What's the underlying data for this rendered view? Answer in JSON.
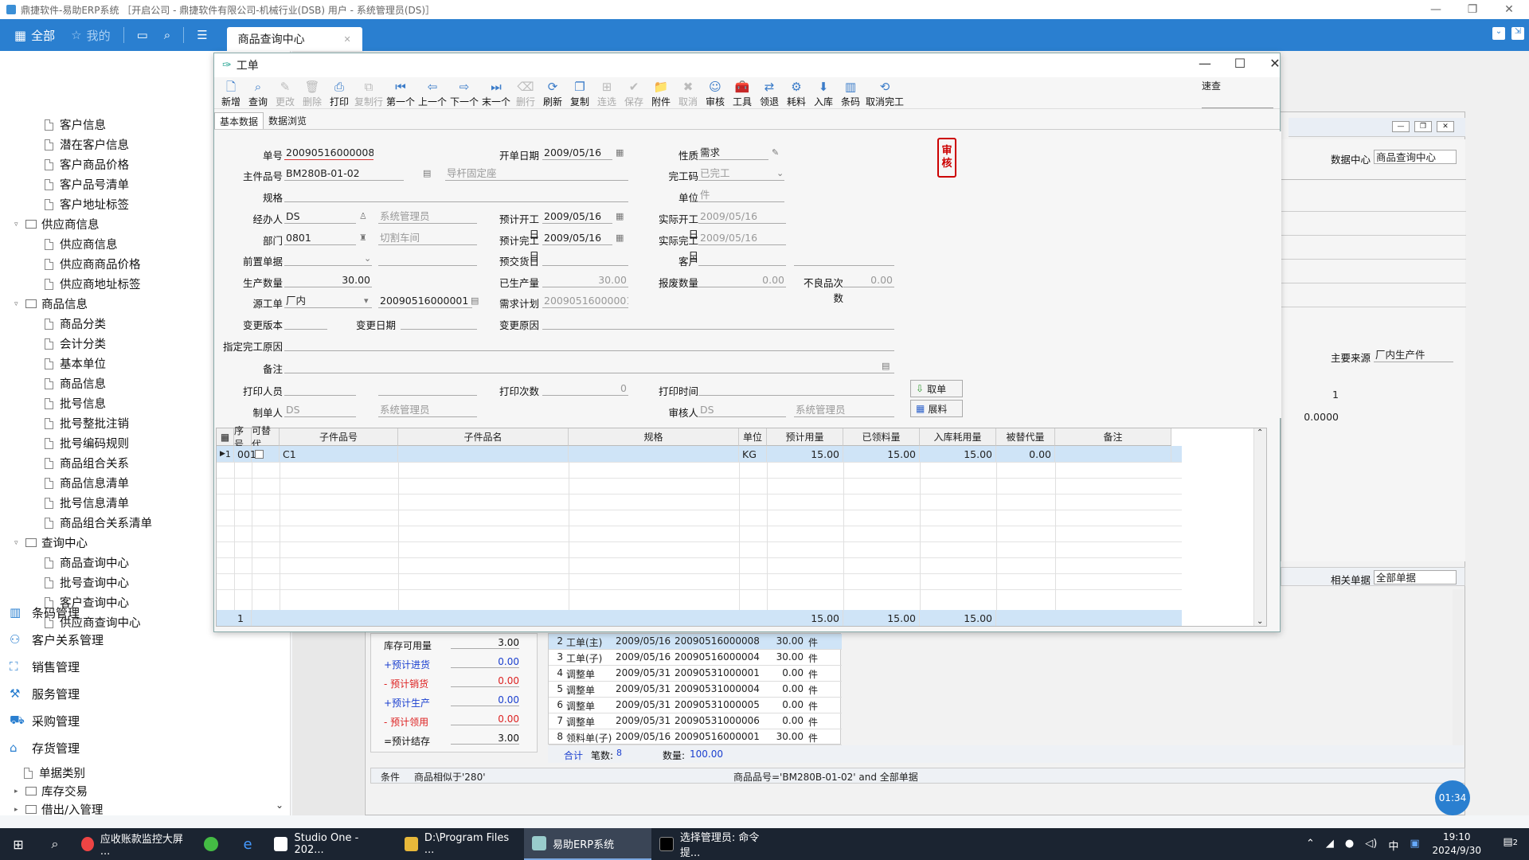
{
  "titlebar": {
    "title": "鼎捷软件-易助ERP系统 ［开启公司 - 鼎捷软件有限公司-机械行业(DSB)  用户 - 系统管理员(DS)］"
  },
  "topnav": {
    "all": "全部",
    "mine": "我的",
    "active_tab": "商品查询中心"
  },
  "leftnav": {
    "rows": [
      {
        "label": "客户信息",
        "indent": 2
      },
      {
        "label": "潜在客户信息",
        "indent": 2
      },
      {
        "label": "客户商品价格",
        "indent": 2
      },
      {
        "label": "客户品号清单",
        "indent": 2
      },
      {
        "label": "客户地址标签",
        "indent": 2
      },
      {
        "label": "供应商信息",
        "indent": 1
      },
      {
        "label": "供应商信息",
        "indent": 2
      },
      {
        "label": "供应商商品价格",
        "indent": 2
      },
      {
        "label": "供应商地址标签",
        "indent": 2
      },
      {
        "label": "商品信息",
        "indent": 1
      },
      {
        "label": "商品分类",
        "indent": 2
      },
      {
        "label": "会计分类",
        "indent": 2
      },
      {
        "label": "基本单位",
        "indent": 2
      },
      {
        "label": "商品信息",
        "indent": 2
      },
      {
        "label": "批号信息",
        "indent": 2
      },
      {
        "label": "批号整批注销",
        "indent": 2
      },
      {
        "label": "批号编码规则",
        "indent": 2
      },
      {
        "label": "商品组合关系",
        "indent": 2
      },
      {
        "label": "商品信息清单",
        "indent": 2
      },
      {
        "label": "批号信息清单",
        "indent": 2
      },
      {
        "label": "商品组合关系清单",
        "indent": 2
      },
      {
        "label": "查询中心",
        "indent": 1
      },
      {
        "label": "商品查询中心",
        "indent": 2
      },
      {
        "label": "批号查询中心",
        "indent": 2
      },
      {
        "label": "客户查询中心",
        "indent": 2
      },
      {
        "label": "供应商查询中心",
        "indent": 2
      }
    ],
    "modules": [
      "条码管理",
      "客户关系管理",
      "销售管理",
      "服务管理",
      "采购管理",
      "存货管理"
    ],
    "subitems": [
      "单据类别",
      "库存交易",
      "借出/入管理"
    ]
  },
  "dialog": {
    "title": "工单",
    "toolbar": [
      "新增",
      "查询",
      "更改",
      "删除",
      "打印",
      "复制行",
      "第一个",
      "上一个",
      "下一个",
      "末一个",
      "删行",
      "刷新",
      "复制",
      "连选",
      "保存",
      "附件",
      "取消",
      "审核",
      "工具",
      "领退",
      "耗料",
      "入库",
      "条码",
      "取消完工"
    ],
    "toolbar_disabled": [
      2,
      3,
      5,
      10,
      13,
      14,
      16
    ],
    "speed_label": "速查",
    "tabs": [
      "基本数据",
      "数据浏览"
    ],
    "form": {
      "order_no_label": "单号",
      "order_no": "20090516000008",
      "open_date_label": "开单日期",
      "open_date": "2009/05/16",
      "nature_label": "性质",
      "nature": "需求",
      "main_item_label": "主件品号",
      "main_item": "BM280B-01-02",
      "main_item_name": "导杆固定座",
      "finish_code_label": "完工码",
      "finish_code": "已完工",
      "spec_label": "规格",
      "unit_label": "单位",
      "unit": "件",
      "handler_label": "经办人",
      "handler": "DS",
      "handler_name": "系统管理员",
      "plan_start_label": "预计开工日",
      "plan_start": "2009/05/16",
      "actual_start_label": "实际开工日",
      "actual_start": "2009/05/16",
      "dept_label": "部门",
      "dept": "0801",
      "dept_name": "切割车间",
      "plan_finish_label": "预计完工日",
      "plan_finish": "2009/05/16",
      "actual_finish_label": "实际完工日",
      "actual_finish": "2009/05/16",
      "pre_doc_label": "前置单据",
      "pre_delivery_label": "预交货日",
      "customer_label": "客户",
      "prod_qty_label": "生产数量",
      "prod_qty": "30.00",
      "produced_label": "已生产量",
      "produced": "30.00",
      "scrap_label": "报废数量",
      "scrap": "0.00",
      "defect_label": "不良品次数",
      "defect": "0.00",
      "source_label": "源工单",
      "source": "厂内",
      "source_no": "20090516000001",
      "demand_label": "需求计划",
      "demand": "20090516000001-0",
      "change_ver_label": "变更版本",
      "change_date_label": "变更日期",
      "change_reason_label": "变更原因",
      "finish_reason_label": "指定完工原因",
      "remark_label": "备注",
      "printer_label": "打印人员",
      "print_count_label": "打印次数",
      "print_count": "0",
      "print_time_label": "打印时间",
      "maker_label": "制单人",
      "maker": "DS",
      "maker_name": "系统管理员",
      "auditor_label": "审核人",
      "auditor": "DS",
      "auditor_name": "系统管理员",
      "seal": [
        "审",
        "核"
      ],
      "fetch_btn": "取单",
      "expand_btn": "展料"
    },
    "grid": {
      "headers": [
        "序号",
        "可替代",
        "子件品号",
        "子件品名",
        "规格",
        "单位",
        "预计用量",
        "已领料量",
        "入库耗用量",
        "被替代量",
        "备注"
      ],
      "rows": [
        {
          "idx": "1",
          "seq": "001",
          "item": "C1",
          "name": "",
          "spec": "",
          "unit": "KG",
          "plan": "15.00",
          "issued": "15.00",
          "used": "15.00",
          "replaced": "0.00",
          "remark": ""
        }
      ],
      "footer": {
        "count": "1",
        "plan": "15.00",
        "issued": "15.00",
        "used": "15.00"
      }
    }
  },
  "bgwindow": {
    "data_center_label": "数据中心",
    "data_center": "商品查询中心",
    "main_source_label": "主要来源",
    "main_source": "厂内生产件",
    "val_1": "1",
    "val_0": "0.0000",
    "related_label": "相关单据",
    "related": "全部单据",
    "stock": [
      {
        "label": "库存可用量",
        "value": "3.00",
        "color": "#111"
      },
      {
        "label": "+预计进货",
        "value": "0.00",
        "color": "#1a3fcf"
      },
      {
        "label": "- 预计销货",
        "value": "0.00",
        "color": "#d22"
      },
      {
        "label": "+预计生产",
        "value": "0.00",
        "color": "#1a3fcf"
      },
      {
        "label": "- 预计领用",
        "value": "0.00",
        "color": "#d22"
      },
      {
        "label": "=预计结存",
        "value": "3.00",
        "color": "#111"
      }
    ],
    "docs": [
      {
        "n": "2",
        "type": "工单(主)",
        "date": "2009/05/16",
        "no": "20090516000008",
        "qty": "30.00",
        "unit": "件"
      },
      {
        "n": "3",
        "type": "工单(子)",
        "date": "2009/05/16",
        "no": "20090516000004",
        "qty": "30.00",
        "unit": "件"
      },
      {
        "n": "4",
        "type": "调整单",
        "date": "2009/05/31",
        "no": "20090531000001",
        "qty": "0.00",
        "unit": "件"
      },
      {
        "n": "5",
        "type": "调整单",
        "date": "2009/05/31",
        "no": "20090531000004",
        "qty": "0.00",
        "unit": "件"
      },
      {
        "n": "6",
        "type": "调整单",
        "date": "2009/05/31",
        "no": "20090531000005",
        "qty": "0.00",
        "unit": "件"
      },
      {
        "n": "7",
        "type": "调整单",
        "date": "2009/05/31",
        "no": "20090531000006",
        "qty": "0.00",
        "unit": "件"
      },
      {
        "n": "8",
        "type": "领料单(子)",
        "date": "2009/05/16",
        "no": "20090516000001",
        "qty": "30.00",
        "unit": "件"
      }
    ],
    "sum_label": "合计",
    "count_label": "笔数:",
    "count": "8",
    "qty_label": "数量:",
    "qty": "100.00",
    "cond_label": "条件",
    "cond1": "商品相似于'280'",
    "cond2": "商品品号='BM280B-01-02' and 全部单据",
    "time_circle": "01:34"
  },
  "taskbar": {
    "items": [
      "应收账款监控大屏 ...",
      "Studio One - 202...",
      "D:\\Program Files ...",
      "易助ERP系统",
      "选择管理员: 命令提..."
    ],
    "ime": "中",
    "time": "19:10",
    "date": "2024/9/30",
    "notif": "2"
  }
}
